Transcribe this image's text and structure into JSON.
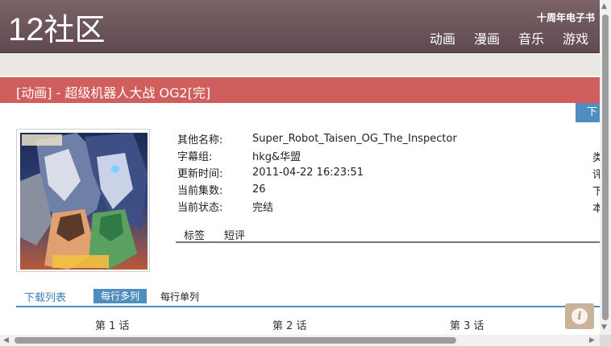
{
  "header": {
    "logo_num": "12",
    "logo_text": "社区",
    "top_note": "十周年电子书",
    "nav": [
      "动画",
      "漫画",
      "音乐",
      "游戏"
    ]
  },
  "title": "[动画] - 超级机器人大战 OG2[完]",
  "download_tab": "下",
  "info": {
    "rows": [
      {
        "label": "其他名称:",
        "value": "Super_Robot_Taisen_OG_The_Inspector"
      },
      {
        "label": "字幕组:",
        "value": "hkg&华盟"
      },
      {
        "label": "更新时间:",
        "value": "2011-04-22 16:23:51"
      },
      {
        "label": "当前集数:",
        "value": "26"
      },
      {
        "label": "当前状态:",
        "value": "完结"
      }
    ],
    "right_chars": [
      "类",
      "评",
      "下",
      "本"
    ]
  },
  "subtabs": [
    "标签",
    "短评"
  ],
  "download": {
    "main_tab": "下载列表",
    "multi_tab": "每行多列",
    "single_tab": "每行单列",
    "episodes": [
      "第 1 话",
      "第 2 话",
      "第 3 话"
    ]
  },
  "icons": {
    "info_button": "info-icon",
    "scroll_left": "arrow-left-icon",
    "scroll_right": "arrow-right-icon",
    "scroll_up": "arrow-up-icon",
    "scroll_down": "arrow-down-icon"
  },
  "colors": {
    "header": "#6e5459",
    "title_bar": "#cf5e5c",
    "accent_blue": "#4f8dbf",
    "info_button": "#c8b29a"
  }
}
